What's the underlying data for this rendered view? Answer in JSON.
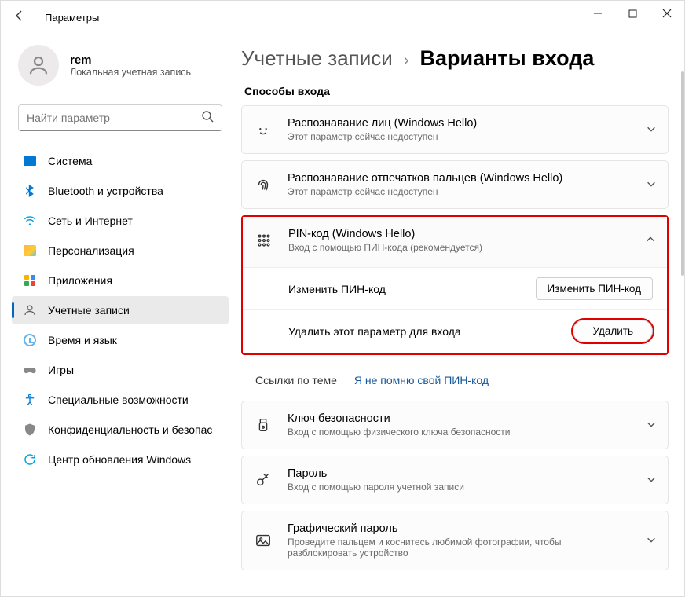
{
  "window": {
    "title": "Параметры"
  },
  "profile": {
    "name": "rem",
    "subtitle": "Локальная учетная запись"
  },
  "search": {
    "placeholder": "Найти параметр"
  },
  "nav": {
    "items": [
      {
        "label": "Система"
      },
      {
        "label": "Bluetooth и устройства"
      },
      {
        "label": "Сеть и Интернет"
      },
      {
        "label": "Персонализация"
      },
      {
        "label": "Приложения"
      },
      {
        "label": "Учетные записи"
      },
      {
        "label": "Время и язык"
      },
      {
        "label": "Игры"
      },
      {
        "label": "Специальные возможности"
      },
      {
        "label": "Конфиденциальность и безопасность"
      },
      {
        "label": "Центр обновления Windows"
      }
    ]
  },
  "breadcrumb": {
    "parent": "Учетные записи",
    "current": "Варианты входа"
  },
  "section": {
    "title": "Способы входа"
  },
  "cards": {
    "face": {
      "title": "Распознавание лиц (Windows Hello)",
      "sub": "Этот параметр сейчас недоступен"
    },
    "finger": {
      "title": "Распознавание отпечатков пальцев (Windows Hello)",
      "sub": "Этот параметр сейчас недоступен"
    },
    "pin": {
      "title": "PIN-код (Windows Hello)",
      "sub": "Вход с помощью ПИН-кода (рекомендуется)"
    },
    "pin_change_label": "Изменить ПИН-код",
    "pin_change_button": "Изменить ПИН-код",
    "pin_remove_label": "Удалить этот параметр для входа",
    "pin_remove_button": "Удалить",
    "related_label": "Ссылки по теме",
    "related_link": "Я не помню свой ПИН-код",
    "seckey": {
      "title": "Ключ безопасности",
      "sub": "Вход с помощью физического ключа безопасности"
    },
    "password": {
      "title": "Пароль",
      "sub": "Вход с помощью пароля учетной записи"
    },
    "picture": {
      "title": "Графический пароль",
      "sub": "Проведите пальцем и коснитесь любимой фотографии, чтобы разблокировать устройство"
    }
  }
}
